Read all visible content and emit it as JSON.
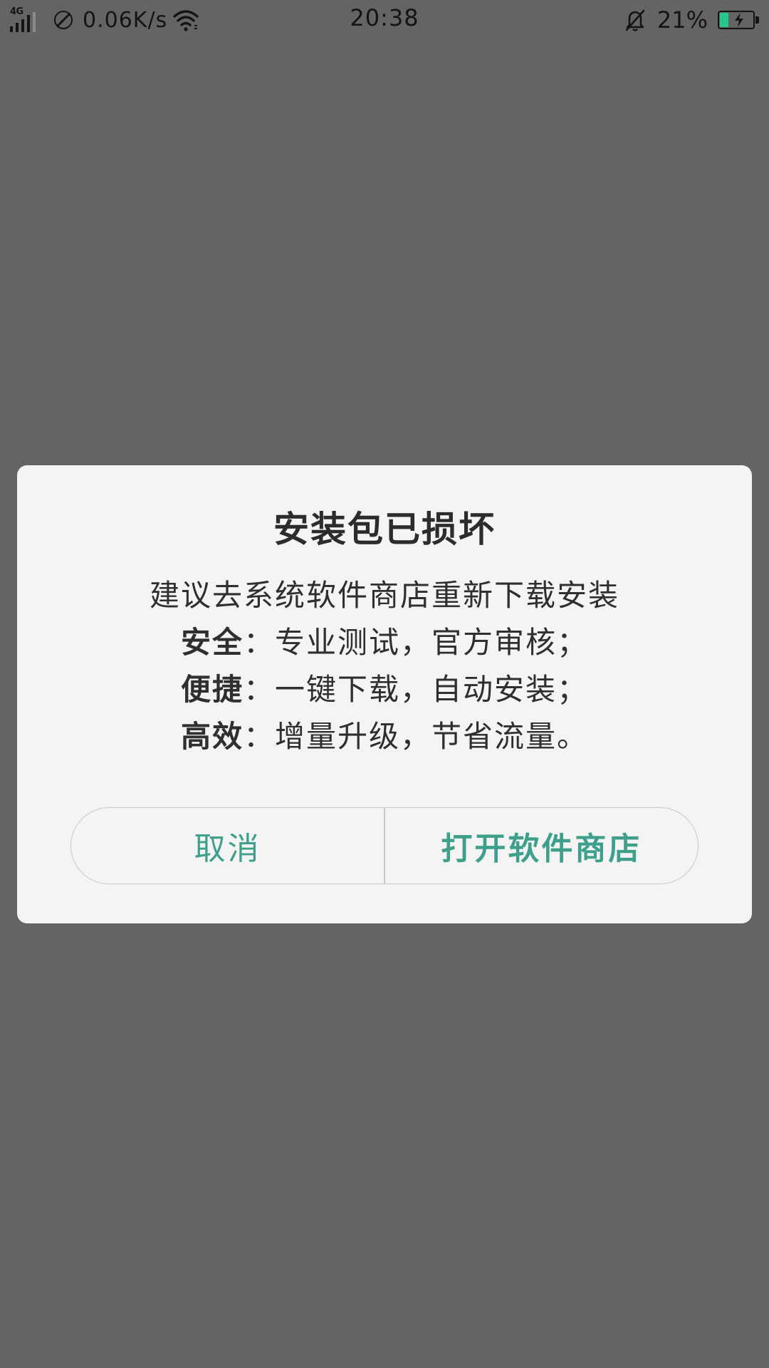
{
  "status_bar": {
    "network_type": "4G",
    "speed": "0.06K/s",
    "time": "20:38",
    "battery_percent": "21%",
    "battery_level": 0.21,
    "battery_charging": true,
    "icons": [
      "signal-icon",
      "no-disturb-icon",
      "wifi-icon",
      "silent-bell-icon",
      "battery-icon"
    ]
  },
  "dialog": {
    "title": "安装包已损坏",
    "subtitle": "建议去系统软件商店重新下载安装",
    "features": [
      {
        "key": "安全",
        "sep": "：",
        "text": "专业测试，官方审核；"
      },
      {
        "key": "便捷",
        "sep": "：",
        "text": "一键下载，自动安装；"
      },
      {
        "key": "高效",
        "sep": "：",
        "text": "增量升级，节省流量。"
      }
    ],
    "cancel_label": "取消",
    "confirm_label": "打开软件商店"
  },
  "colors": {
    "overlay": "#646464",
    "dialog_bg": "#f4f4f4",
    "accent": "#3ea08a",
    "battery_fill": "#22c98b"
  }
}
